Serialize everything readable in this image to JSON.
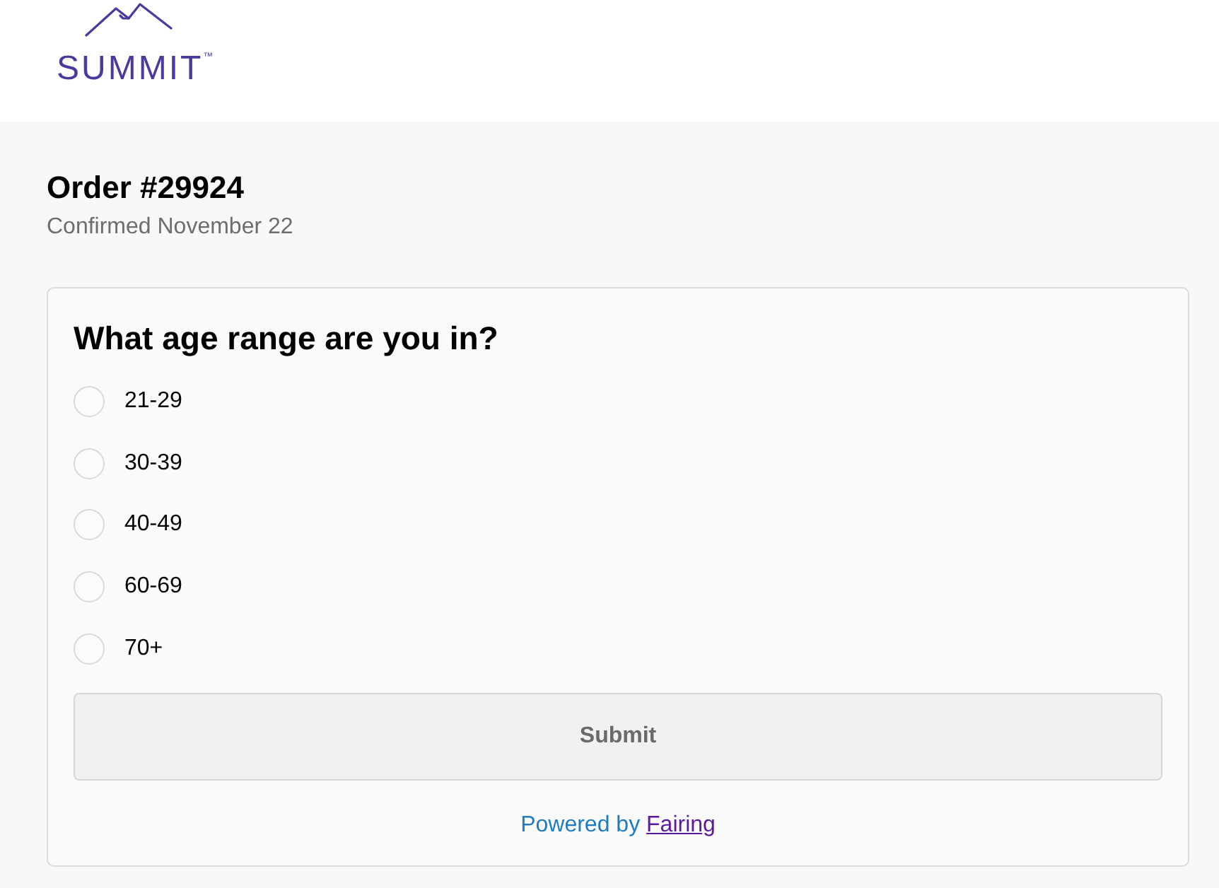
{
  "header": {
    "logo": {
      "text": "SUMMIT$^{™}$"
    }
  },
  "order": {
    "title": "Order #29924",
    "subtitle": "Confirmed November 22"
  },
  "survey": {
    "question": "What age range are you in?",
    "options": [
      {
        "label": "21-29",
        "selected": false
      },
      {
        "label": "30-39",
        "selected": false
      },
      {
        "label": "40-49",
        "selected": false
      },
      {
        "label": "60-69",
        "selected": false
      },
      {
        "label": "70+",
        "selected": false
      }
    ],
    "submit": {
      "label": "Submit",
      "disabled": true
    },
    "footer": {
      "text": "Powered by",
      "link": "Fairing"
    }
  }
}
